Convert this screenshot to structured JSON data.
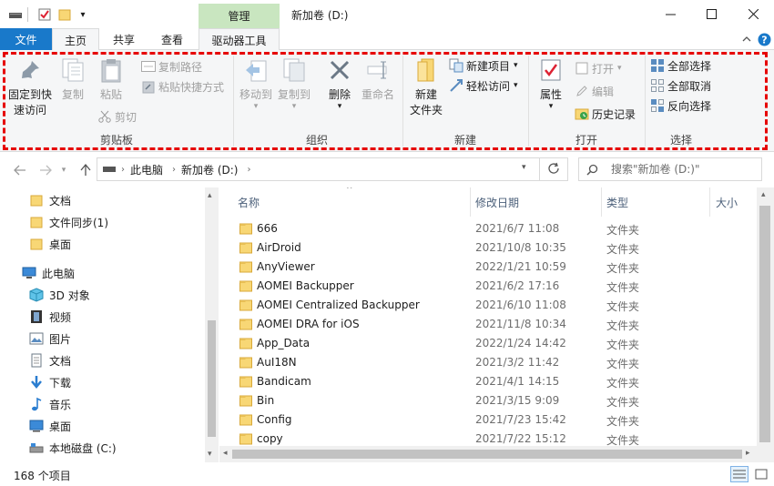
{
  "window": {
    "title": "新加卷 (D:)",
    "context_tab": "管理",
    "minimize": "—",
    "maximize": "☐",
    "close": "✕"
  },
  "tabs": {
    "file": "文件",
    "home": "主页",
    "share": "共享",
    "view": "查看",
    "drive_tools": "驱动器工具"
  },
  "ribbon": {
    "clipboard": {
      "label": "剪贴板",
      "pin_line1": "固定到快",
      "pin_line2": "速访问",
      "copy": "复制",
      "paste": "粘贴",
      "copy_path": "复制路径",
      "paste_shortcut": "粘贴快捷方式",
      "cut": "剪切"
    },
    "organize": {
      "label": "组织",
      "move_to": "移动到",
      "copy_to": "复制到",
      "delete": "删除",
      "rename": "重命名"
    },
    "new": {
      "label": "新建",
      "new_folder_line1": "新建",
      "new_folder_line2": "文件夹",
      "new_item": "新建项目",
      "easy_access": "轻松访问"
    },
    "open": {
      "label": "打开",
      "properties": "属性",
      "open": "打开",
      "edit": "编辑",
      "history": "历史记录"
    },
    "select": {
      "label": "选择",
      "select_all": "全部选择",
      "select_none": "全部取消",
      "invert": "反向选择"
    }
  },
  "address": {
    "parts": [
      "此电脑",
      "新加卷 (D:)"
    ],
    "search_placeholder": "搜索\"新加卷 (D:)\""
  },
  "nav": {
    "quick": [
      "文档",
      "文件同步(1)",
      "桌面"
    ],
    "this_pc": "此电脑",
    "pc_items": [
      "3D 对象",
      "视频",
      "图片",
      "文档",
      "下载",
      "音乐",
      "桌面",
      "本地磁盘 (C:)"
    ]
  },
  "columns": {
    "name": "名称",
    "date": "修改日期",
    "type": "类型",
    "size": "大小"
  },
  "files": [
    {
      "name": "666",
      "date": "2021/6/7 11:08",
      "type": "文件夹"
    },
    {
      "name": "AirDroid",
      "date": "2021/10/8 10:35",
      "type": "文件夹"
    },
    {
      "name": "AnyViewer",
      "date": "2022/1/21 10:59",
      "type": "文件夹"
    },
    {
      "name": "AOMEI Backupper",
      "date": "2021/6/2 17:16",
      "type": "文件夹"
    },
    {
      "name": "AOMEI Centralized Backupper",
      "date": "2021/6/10 11:08",
      "type": "文件夹"
    },
    {
      "name": "AOMEI DRA for iOS",
      "date": "2021/11/8 10:34",
      "type": "文件夹"
    },
    {
      "name": "App_Data",
      "date": "2022/1/24 14:42",
      "type": "文件夹"
    },
    {
      "name": "AuI18N",
      "date": "2021/3/2 11:42",
      "type": "文件夹"
    },
    {
      "name": "Bandicam",
      "date": "2021/4/1 14:15",
      "type": "文件夹"
    },
    {
      "name": "Bin",
      "date": "2021/3/15 9:09",
      "type": "文件夹"
    },
    {
      "name": "Config",
      "date": "2021/7/23 15:42",
      "type": "文件夹"
    },
    {
      "name": "copy",
      "date": "2021/7/22 15:12",
      "type": "文件夹"
    }
  ],
  "status": {
    "count": "168 个项目"
  },
  "colors": {
    "file_tab": "#1979ca",
    "manage_tab": "#c9e6c0",
    "highlight": "#e60000",
    "folder": "#f8d775"
  }
}
